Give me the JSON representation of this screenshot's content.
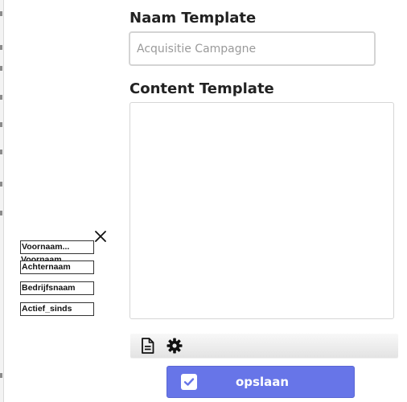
{
  "form": {
    "name_label": "Naam Template",
    "name_placeholder": "Acquisitie Campagne",
    "content_label": "Content Template"
  },
  "toolbar": {
    "buttons": [
      {
        "icon": "document-icon"
      },
      {
        "icon": "gear-icon"
      }
    ]
  },
  "save_button": {
    "label": "opslaan",
    "icon": "checkbox-checked-icon"
  },
  "variables": {
    "close_icon": "close-icon",
    "chips": [
      "Voornaam...",
      "Achternaam",
      "Bedrijfsnaam",
      "Actief_sinds"
    ],
    "drag_ghost_label": "Voornaam"
  },
  "colors": {
    "primary": "#6775e8",
    "border": "#d4d4d4",
    "placeholder": "#9a9a9a"
  }
}
